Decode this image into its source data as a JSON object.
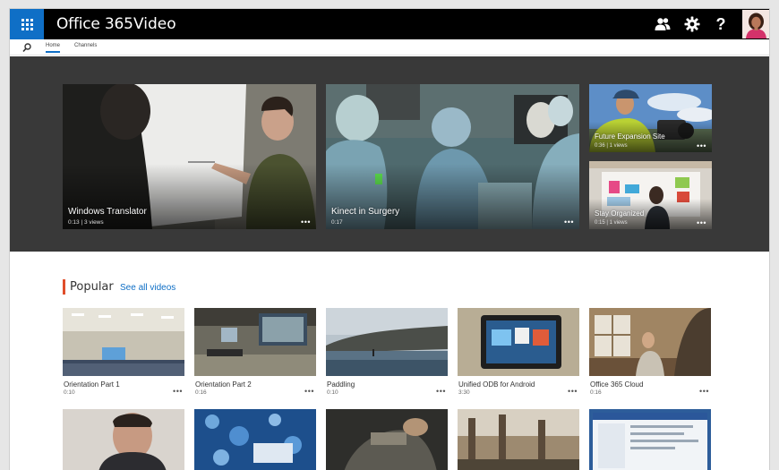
{
  "suite": {
    "brand": "Office 365",
    "app": "Video",
    "icons": [
      "app-launcher-icon",
      "people-icon",
      "gear-icon",
      "help-icon"
    ],
    "help_label": "?"
  },
  "nav": {
    "tabs": [
      {
        "label": "Home",
        "active": true
      },
      {
        "label": "Channels",
        "active": false
      }
    ]
  },
  "hero": {
    "tiles": [
      {
        "title": "Windows Translator",
        "meta": "0:13 | 3 views"
      },
      {
        "title": "Kinect in Surgery",
        "meta": "0:17"
      },
      {
        "title": "Future Expansion Site",
        "meta": "0:36 | 1 views"
      },
      {
        "title": "Stay Organized",
        "meta": "0:15 | 1 views"
      }
    ],
    "more": "•••"
  },
  "popular": {
    "title": "Popular",
    "see_all": "See all videos",
    "videos": [
      {
        "title": "Orientation Part 1",
        "duration": "0:10"
      },
      {
        "title": "Orientation Part 2",
        "duration": "0:16"
      },
      {
        "title": "Paddling",
        "duration": "0:10"
      },
      {
        "title": "Unified ODB for Android",
        "duration": "3:30"
      },
      {
        "title": "Office 365 Cloud",
        "duration": "0:16"
      }
    ],
    "more": "•••"
  },
  "colors": {
    "accent": "#0f6fc6",
    "section_marker": "#e04e2b",
    "suitebar": "#000000",
    "hero_bg": "#393939"
  }
}
